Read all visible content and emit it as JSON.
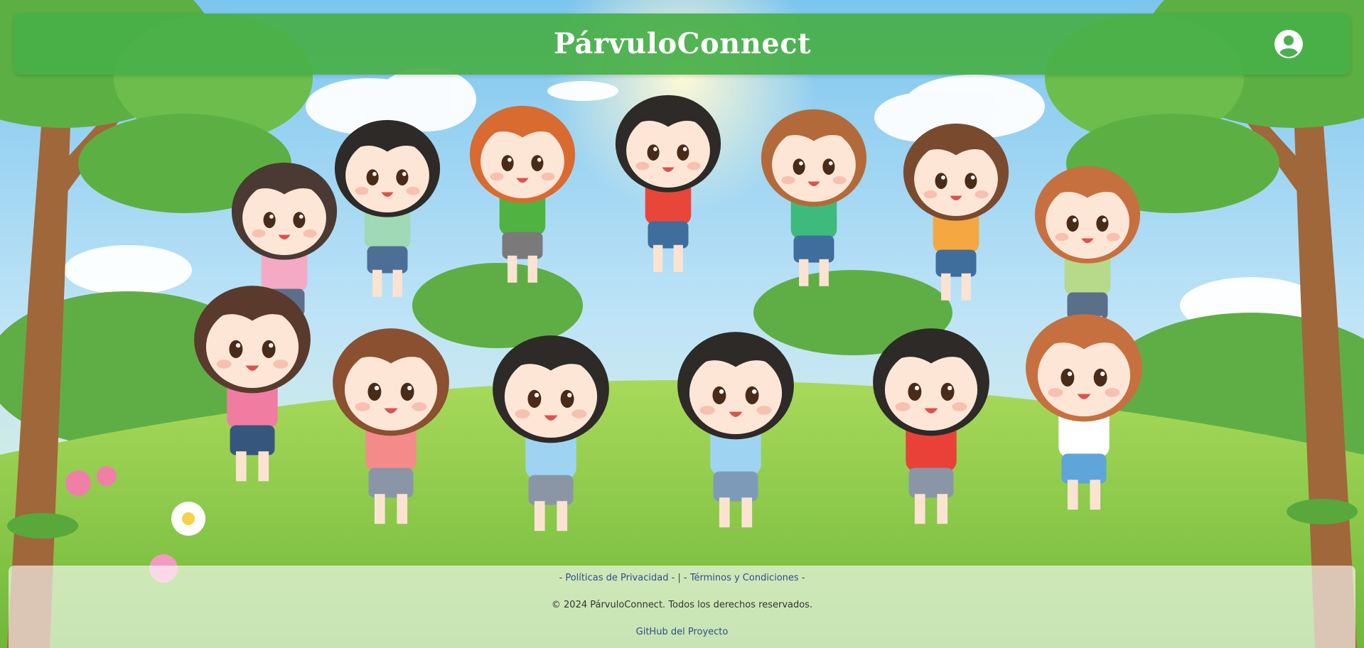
{
  "header": {
    "app_title": "PárvuloConnect",
    "user_icon": "user-circle-icon",
    "color": "#4caf50"
  },
  "footer": {
    "dash_left": "-",
    "privacy_link": "Políticas de Privacidad",
    "separator": "- | -",
    "terms_link": "Términos y Condiciones",
    "dash_right": "-",
    "copyright": "© 2024 PárvuloConnect. Todos los derechos reservados.",
    "github_link": "GitHub del Proyecto",
    "link_color": "#2e4f8c"
  },
  "background": {
    "image": "cartoon-children-holding-hands-in-park-illustration"
  }
}
